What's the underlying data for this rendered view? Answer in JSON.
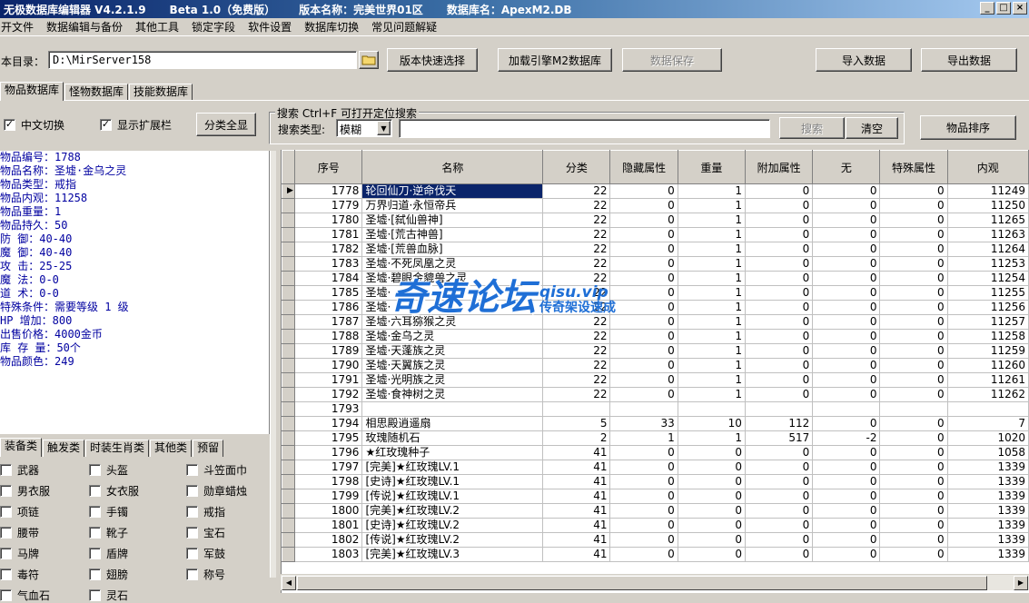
{
  "window": {
    "title_parts": [
      "无极数据库编辑器 V4.2.1.9",
      "Beta 1.0（免费版）",
      "版本名称：完美世界01区",
      "数据库名：ApexM2.DB"
    ],
    "controls": [
      "_",
      "□",
      "×"
    ]
  },
  "menu": [
    "开文件",
    "数据编辑与备份",
    "其他工具",
    "锁定字段",
    "软件设置",
    "数据库切换",
    "常见问题解疑"
  ],
  "toolbar": {
    "dir_label": "本目录：",
    "dir_value": "D:\\MirServer158",
    "quick_select": "版本快速选择",
    "load_engine_db": "加载引擎M2数据库",
    "save_data": "数据保存",
    "import_data": "导入数据",
    "export_data": "导出数据"
  },
  "main_tabs": [
    "物品数据库",
    "怪物数据库",
    "技能数据库"
  ],
  "options": {
    "chinese_switch": "中文切换",
    "show_ext": "显示扩展栏",
    "category_all": "分类全显"
  },
  "search": {
    "title": "搜索   Ctrl+F 可打开定位搜索",
    "type_label": "搜索类型:",
    "type_value": "模糊",
    "search_btn": "搜索",
    "clear_btn": "清空",
    "sort_btn": "物品排序"
  },
  "item_info": [
    "物品编号：1788",
    "物品名称：圣墟·金乌之灵",
    "物品类型：戒指",
    "物品内观：11258",
    "物品重量：1",
    "物品持久：50",
    "防    御：40-40",
    "魔    御：40-40",
    "攻    击：25-25",
    "魔    法：0-0",
    "道    术：0-0",
    "特殊条件：需要等级 1 级",
    "HP  增加：800",
    "出售价格：4000金币",
    "库 存 量：50个",
    "物品颜色：249"
  ],
  "category_tabs": [
    "装备类",
    "触发类",
    "时装生肖类",
    "其他类",
    "预留"
  ],
  "categories": [
    "武器",
    "头盔",
    "斗笠面巾",
    "男衣服",
    "女衣服",
    "勋章蜡烛",
    "项链",
    "手镯",
    "戒指",
    "腰带",
    "靴子",
    "宝石",
    "马牌",
    "盾牌",
    "军鼓",
    "毒符",
    "翅膀",
    "称号",
    "气血石",
    "灵石"
  ],
  "table": {
    "headers": [
      "序号",
      "名称",
      "分类",
      "隐藏属性",
      "重量",
      "附加属性",
      "无",
      "特殊属性",
      "内观"
    ],
    "rows": [
      [
        "1778",
        "轮回仙刀·逆命伐天",
        "22",
        "0",
        "1",
        "0",
        "0",
        "0",
        "11249"
      ],
      [
        "1779",
        "万界归道·永恒帝兵",
        "22",
        "0",
        "1",
        "0",
        "0",
        "0",
        "11250"
      ],
      [
        "1780",
        "圣墟·[弑仙兽神]",
        "22",
        "0",
        "1",
        "0",
        "0",
        "0",
        "11265"
      ],
      [
        "1781",
        "圣墟·[荒古神兽]",
        "22",
        "0",
        "1",
        "0",
        "0",
        "0",
        "11263"
      ],
      [
        "1782",
        "圣墟·[荒兽血脉]",
        "22",
        "0",
        "1",
        "0",
        "0",
        "0",
        "11264"
      ],
      [
        "1783",
        "圣墟·不死凤凰之灵",
        "22",
        "0",
        "1",
        "0",
        "0",
        "0",
        "11253"
      ],
      [
        "1784",
        "圣墟·碧眼金貔兽之灵",
        "22",
        "0",
        "1",
        "0",
        "0",
        "0",
        "11254"
      ],
      [
        "1785",
        "圣墟·",
        "22",
        "0",
        "1",
        "0",
        "0",
        "0",
        "11255"
      ],
      [
        "1786",
        "圣墟·",
        "22",
        "0",
        "1",
        "0",
        "0",
        "0",
        "11256"
      ],
      [
        "1787",
        "圣墟·六耳猕猴之灵",
        "22",
        "0",
        "1",
        "0",
        "0",
        "0",
        "11257"
      ],
      [
        "1788",
        "圣墟·金乌之灵",
        "22",
        "0",
        "1",
        "0",
        "0",
        "0",
        "11258"
      ],
      [
        "1789",
        "圣墟·天蓬族之灵",
        "22",
        "0",
        "1",
        "0",
        "0",
        "0",
        "11259"
      ],
      [
        "1790",
        "圣墟·天翼族之灵",
        "22",
        "0",
        "1",
        "0",
        "0",
        "0",
        "11260"
      ],
      [
        "1791",
        "圣墟·光明族之灵",
        "22",
        "0",
        "1",
        "0",
        "0",
        "0",
        "11261"
      ],
      [
        "1792",
        "圣墟·食神树之灵",
        "22",
        "0",
        "1",
        "0",
        "0",
        "0",
        "11262"
      ],
      [
        "1793",
        "",
        "",
        "",
        "",
        "",
        "",
        "",
        ""
      ],
      [
        "1794",
        "相思殿逍遥扇",
        "5",
        "33",
        "10",
        "112",
        "0",
        "0",
        "7"
      ],
      [
        "1795",
        "玫瑰随机石",
        "2",
        "1",
        "1",
        "517",
        "-2",
        "0",
        "1020"
      ],
      [
        "1796",
        "★红玫瑰种子",
        "41",
        "0",
        "0",
        "0",
        "0",
        "0",
        "1058"
      ],
      [
        "1797",
        "[完美]★红玫瑰LV.1",
        "41",
        "0",
        "0",
        "0",
        "0",
        "0",
        "1339"
      ],
      [
        "1798",
        "[史诗]★红玫瑰LV.1",
        "41",
        "0",
        "0",
        "0",
        "0",
        "0",
        "1339"
      ],
      [
        "1799",
        "[传说]★红玫瑰LV.1",
        "41",
        "0",
        "0",
        "0",
        "0",
        "0",
        "1339"
      ],
      [
        "1800",
        "[完美]★红玫瑰LV.2",
        "41",
        "0",
        "0",
        "0",
        "0",
        "0",
        "1339"
      ],
      [
        "1801",
        "[史诗]★红玫瑰LV.2",
        "41",
        "0",
        "0",
        "0",
        "0",
        "0",
        "1339"
      ],
      [
        "1802",
        "[传说]★红玫瑰LV.2",
        "41",
        "0",
        "0",
        "0",
        "0",
        "0",
        "1339"
      ],
      [
        "1803",
        "[完美]★红玫瑰LV.3",
        "41",
        "0",
        "0",
        "0",
        "0",
        "0",
        "1339"
      ]
    ]
  },
  "watermark": {
    "big": "奇速论坛",
    "url": "qisu.vip",
    "sub": "传奇架设速成"
  }
}
